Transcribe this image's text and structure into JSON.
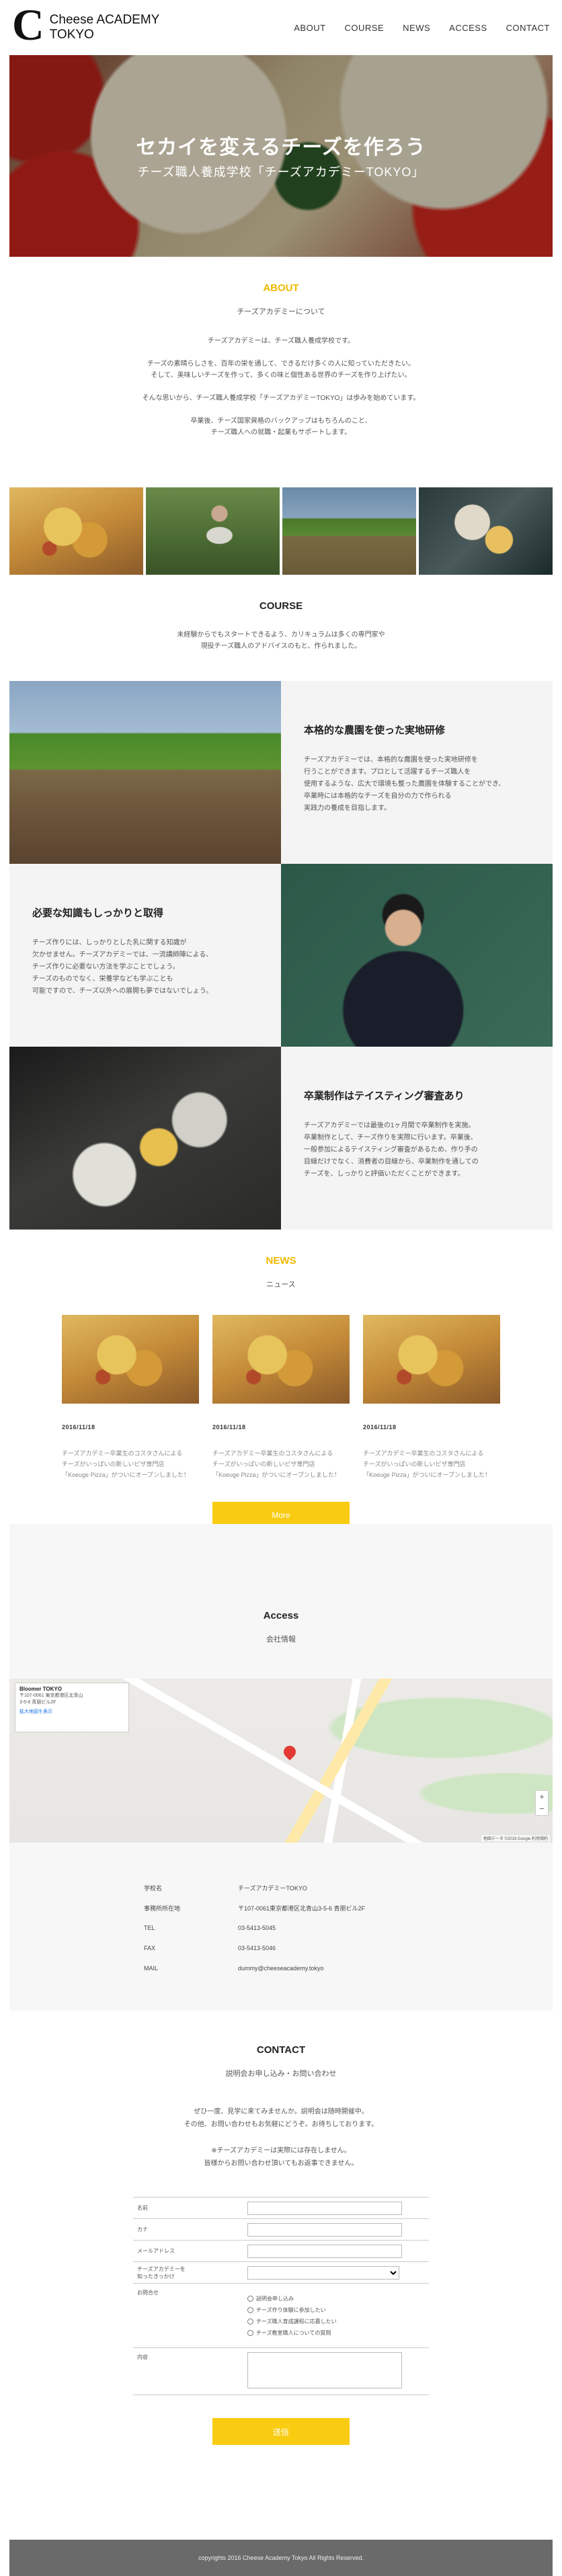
{
  "header": {
    "logo_mark": "C",
    "logo_line1": "Cheese ACADEMY",
    "logo_line2": "TOKYO",
    "nav": [
      "ABOUT",
      "COURSE",
      "NEWS",
      "ACCESS",
      "CONTACT"
    ]
  },
  "hero": {
    "title": "セカイを変えるチーズを作ろう",
    "subtitle": "チーズ職人養成学校「チーズアカデミーTOKYO」"
  },
  "about": {
    "title": "ABOUT",
    "subtitle": "チーズアカデミーについて",
    "p1": "チーズアカデミーは、チーズ職人養成学校です。",
    "p2a": "チーズの素晴らしさを、百年の栄を通して、できるだけ多くの人に知っていただきたい。",
    "p2b": "そして、美味しいチーズを作って、多くの味と個性ある世界のチーズを作り上げたい。",
    "p3": "そんな思いから、チーズ職人養成学校「チーズアカデミーTOKYO」は歩みを始めています。",
    "p4a": "卒業後、チーズ国家資格のバックアップはもちろんのこと、",
    "p4b": "チーズ職人への就職・起業もサポートします。"
  },
  "course": {
    "title": "COURSE",
    "p1": "未経験からでもスタートできるよう、カリキュラムは多くの専門家や",
    "p2": "現役チーズ職人のアドバイスのもと、作られました。",
    "items": [
      {
        "title": "本格的な農園を使った実地研修",
        "l1": "チーズアカデミーでは、本格的な農園を使った実地研修を",
        "l2": "行うことができます。プロとして活躍するチーズ職人を",
        "l3": "使用するような、広大で環境も整った農園を体験することができ、",
        "l4": "卒業時には本格的なチーズを自分の力で作られる",
        "l5": "実践力の養成を目指します。"
      },
      {
        "title": "必要な知識もしっかりと取得",
        "l1": "チーズ作りには、しっかりとした乳に関する知識が",
        "l2": "欠かせません。チーズアカデミーでは、一流講師陣による、",
        "l3": "チーズ作りに必要ない方法を学ぶことでしょう。",
        "l4": "チーズのものでなく、栄養学なども学ぶことも",
        "l5": "可能ですので、チーズ以外への展開も夢ではないでしょう。"
      },
      {
        "title": "卒業制作はテイスティング審査あり",
        "l1": "チーズアカデミーでは最後の1ヶ月間で卒業制作を実施。",
        "l2": "卒業制作として、チーズ作りを実際に行います。卒業後、",
        "l3": "一般参加によるテイスティング審査があるため、作り手の",
        "l4": "目線だけでなく、消費者の目線から、卒業制作を通しての",
        "l5": "チーズを、しっかりと評価いただくことができます。"
      }
    ]
  },
  "news": {
    "title": "NEWS",
    "subtitle": "ニュース",
    "items": [
      {
        "date": "2016/11/18",
        "l1": "チーズアカデミー卒業生のコスタさんによる",
        "l2": "チーズがいっぱいの新しいピザ専門店",
        "l3": "「Koeuge Pizza」がついにオープンしました！"
      },
      {
        "date": "2016/11/18",
        "l1": "チーズアカデミー卒業生のコスタさんによる",
        "l2": "チーズがいっぱいの新しいピザ専門店",
        "l3": "「Koeuge Pizza」がついにオープンしました！"
      },
      {
        "date": "2016/11/18",
        "l1": "チーズアカデミー卒業生のコスタさんによる",
        "l2": "チーズがいっぱいの新しいピザ専門店",
        "l3": "「Koeuge Pizza」がついにオープンしました！"
      }
    ],
    "more": "More"
  },
  "access": {
    "title": "Access",
    "subtitle": "会社情報",
    "map": {
      "card_title": "Bloomer TOKYO",
      "card_l1": "〒107-0061 東京都港区北青山",
      "card_l2": "3-5-6 青朋ビル2F",
      "card_link": "拡大地図を表示",
      "zoom_in": "+",
      "zoom_out": "−",
      "copyright": "地図データ ©2019 Google 利用規約"
    },
    "rows": [
      {
        "k": "学校名",
        "v": "チーズアカデミーTOKYO"
      },
      {
        "k": "事務所所在地",
        "v": "〒107-0061東京都港区北青山3-5-6 青朋ビル2F"
      },
      {
        "k": "TEL",
        "v": "03-5413-5045"
      },
      {
        "k": "FAX",
        "v": "03-5413-5046"
      },
      {
        "k": "MAIL",
        "v": "dummy@cheeseacademy.tokyo"
      }
    ]
  },
  "contact": {
    "title": "CONTACT",
    "subtitle": "説明会お申し込み・お問い合わせ",
    "p1": "ぜひ一度、見学に来てみませんか。説明会は随時開催中。",
    "p2": "その他、お問い合わせもお気軽にどうぞ。お待ちしております。",
    "p3": "※チーズアカデミーは実際には存在しません。",
    "p4": "皆様からお問い合わせ頂いてもお返事できません。",
    "form": {
      "name": "名前",
      "kana": "カナ",
      "email": "メールアドレス",
      "how1": "チーズアカデミーを",
      "how2": "知ったきっかけ",
      "select_value": "",
      "purpose": "お問合せ",
      "opts": [
        "説明会申し込み",
        "チーズ作り体験に参加したい",
        "チーズ職人育成課程に応募したい",
        "チーズ教室職人についての質問"
      ],
      "message": "内容",
      "submit": "送信"
    }
  },
  "footer": {
    "copy": "copyrights 2016 Cheese Academy Tokyo All Rights Reserved."
  }
}
